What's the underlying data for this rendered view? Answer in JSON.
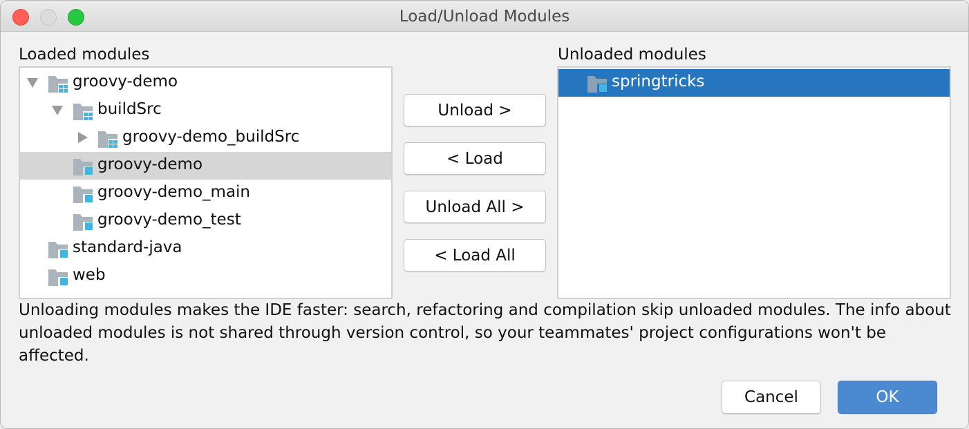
{
  "window": {
    "title": "Load/Unload Modules",
    "controls": [
      "close",
      "minimize",
      "maximize"
    ]
  },
  "loaded": {
    "label": "Loaded modules",
    "items": [
      {
        "name": "groovy-demo",
        "level": 0,
        "expander": "expanded",
        "icon": "module-group-folder-icon"
      },
      {
        "name": "buildSrc",
        "level": 1,
        "expander": "expanded",
        "icon": "module-group-folder-icon"
      },
      {
        "name": "groovy-demo_buildSrc",
        "level": 2,
        "expander": "collapsed",
        "icon": "module-group-folder-icon"
      },
      {
        "name": "groovy-demo",
        "level": 1,
        "expander": "none",
        "icon": "module-folder-icon",
        "selected": true
      },
      {
        "name": "groovy-demo_main",
        "level": 1,
        "expander": "none",
        "icon": "module-folder-icon"
      },
      {
        "name": "groovy-demo_test",
        "level": 1,
        "expander": "none",
        "icon": "module-folder-icon"
      },
      {
        "name": "standard-java",
        "level": 0,
        "expander": "none",
        "icon": "module-folder-icon"
      },
      {
        "name": "web",
        "level": 0,
        "expander": "none",
        "icon": "module-folder-icon"
      }
    ]
  },
  "unloaded": {
    "label": "Unloaded modules",
    "items": [
      {
        "name": "springtricks",
        "icon": "module-folder-icon",
        "selected": true
      }
    ]
  },
  "actions": {
    "unload": "Unload >",
    "load": "< Load",
    "unload_all": "Unload All >",
    "load_all": "< Load All"
  },
  "description": "Unloading modules makes the IDE faster: search, refactoring and compilation skip unloaded modules. The info about unloaded modules is not shared through version control, so your teammates' project configurations won't be affected.",
  "footer": {
    "cancel": "Cancel",
    "ok": "OK"
  },
  "colors": {
    "selection_blue": "#2675bf",
    "selection_gray": "#d6d6d6",
    "primary_button": "#4b8ad0",
    "module_badge": "#40b6e0",
    "folder_gray": "#a9b4bc"
  }
}
